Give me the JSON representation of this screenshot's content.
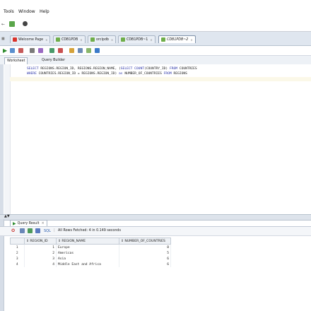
{
  "menu": [
    "Tools",
    "Window",
    "Help"
  ],
  "tabs": [
    {
      "label": "Welcome Page",
      "active": false
    },
    {
      "label": "CDB1PDB",
      "active": false
    },
    {
      "label": "orclpdb",
      "active": false
    },
    {
      "label": "CDB1PDB~1",
      "active": false
    },
    {
      "label": "CDB1PDB~2",
      "active": true
    }
  ],
  "subtabs": [
    "Worksheet",
    "Query Builder"
  ],
  "sql": {
    "line1": [
      "SELECT",
      " REGIONS.REGION_ID, REGIONS.REGION_NAME, (",
      "SELECT COUNT",
      "(COUNTRY_ID) ",
      "FROM",
      " COUNTRIES"
    ],
    "line2": [
      "WHERE",
      " COUNTRIES.REGION_ID = REGIONS.REGION_ID) ",
      "as",
      " NUMBER_OF_COUNTRIES ",
      "FROM",
      " REGIONS"
    ]
  },
  "result": {
    "tab_label": "Query Result",
    "sql_label": "SQL",
    "status": "All Rows Fetched: 4 in 0.149 seconds",
    "columns": [
      "REGION_ID",
      "REGION_NAME",
      "NUMBER_OF_COUNTRIES"
    ],
    "rows": [
      {
        "n": "1",
        "id": "1",
        "name": "Europe",
        "count": "8"
      },
      {
        "n": "2",
        "id": "2",
        "name": "Americas",
        "count": "5"
      },
      {
        "n": "3",
        "id": "3",
        "name": "Asia",
        "count": "6"
      },
      {
        "n": "4",
        "id": "4",
        "name": "Middle East and Africa",
        "count": "6"
      }
    ]
  }
}
